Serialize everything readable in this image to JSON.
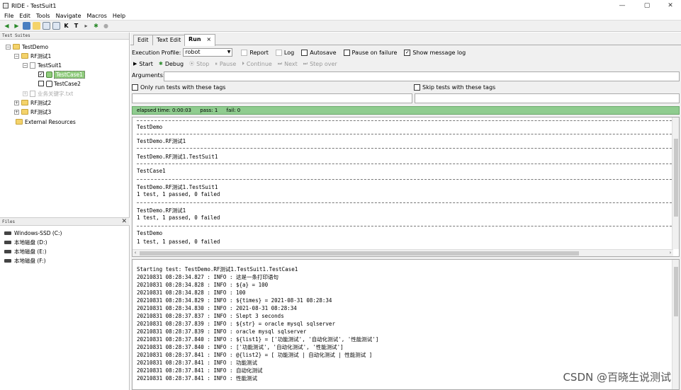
{
  "window": {
    "title": "RIDE - TestSuit1",
    "minimize": "—",
    "maximize": "▢",
    "close": "✕"
  },
  "menu": [
    "File",
    "Edit",
    "Tools",
    "Navigate",
    "Macros",
    "Help"
  ],
  "left": {
    "suites_header": "Test Suites",
    "tree": [
      {
        "label": "TestDemo"
      },
      {
        "label": "RF测试1"
      },
      {
        "label": "TestSuit1"
      },
      {
        "label": "TestCase1"
      },
      {
        "label": "TestCase2"
      },
      {
        "label": "业务关键字.txt"
      },
      {
        "label": "RF测试2"
      },
      {
        "label": "RF测试3"
      },
      {
        "label": "External Resources"
      }
    ],
    "files_header": "Files",
    "files_close": "✕",
    "drives": [
      "Windows-SSD (C:)",
      "本地磁盘 (D:)",
      "本地磁盘 (E:)",
      "本地磁盘 (F:)"
    ]
  },
  "tabs": [
    {
      "label": "Edit"
    },
    {
      "label": "Text Edit"
    },
    {
      "label": "Run"
    }
  ],
  "tab_close": "×",
  "run": {
    "execution_profile_label": "Execution Profile:",
    "execution_profile_value": "robot",
    "report_label": "Report",
    "log_label": "Log",
    "autosave_label": "Autosave",
    "pause_on_failure_label": "Pause on failure",
    "show_message_log_label": "Show message log",
    "buttons": {
      "start": "Start",
      "debug": "Debug",
      "stop": "Stop",
      "pause": "Pause",
      "continue": "Continue",
      "next": "Next",
      "step_over": "Step over"
    },
    "arguments_label": "Arguments:",
    "only_run_tags_label": "Only run tests with these tags",
    "skip_tags_label": "Skip tests with these tags",
    "status": {
      "elapsed": "elapsed time: 0:00:03",
      "pass": "pass: 1",
      "fail": "fail: 0"
    }
  },
  "output_lines": [
    "TestDemo",
    "TestDemo.RF测试1",
    "TestDemo.RF测试1.TestSuit1",
    "TestCase1",
    "TestDemo.RF测试1.TestSuit1",
    "1 test, 1 passed, 0 failed",
    "TestDemo.RF测试1",
    "1 test, 1 passed, 0 failed",
    "TestDemo",
    "1 test, 1 passed, 0 failed"
  ],
  "log_lines": [
    "Starting test: TestDemo.RF测试1.TestSuit1.TestCase1",
    "20210831 08:28:34.827 :  INFO : 这是一条打印语句",
    "20210831 08:28:34.828 :  INFO : ${a} = 100",
    "20210831 08:28:34.828 :  INFO : 100",
    "20210831 08:28:34.829 :  INFO : ${times} = 2021-08-31 08:28:34",
    "20210831 08:28:34.830 :  INFO : 2021-08-31 08:28:34",
    "20210831 08:28:37.837 :  INFO : Slept 3 seconds",
    "20210831 08:28:37.839 :  INFO : ${str} = oracle mysql sqlserver",
    "20210831 08:28:37.839 :  INFO : oracle mysql sqlserver",
    "20210831 08:28:37.840 :  INFO : ${list1} = ['功能测试', '自动化测试', '性能测试']",
    "20210831 08:28:37.840 :  INFO : ['功能测试', '自动化测试', '性能测试']",
    "20210831 08:28:37.841 :  INFO : @{list2} = [ 功能测试 | 自动化测试 | 性能测试 ]",
    "20210831 08:28:37.841 :  INFO : 功能测试",
    "20210831 08:28:37.841 :  INFO : 自动化测试",
    "20210831 08:28:37.841 :  INFO : 性能测试"
  ],
  "watermark": "CSDN @百晓生说测试"
}
